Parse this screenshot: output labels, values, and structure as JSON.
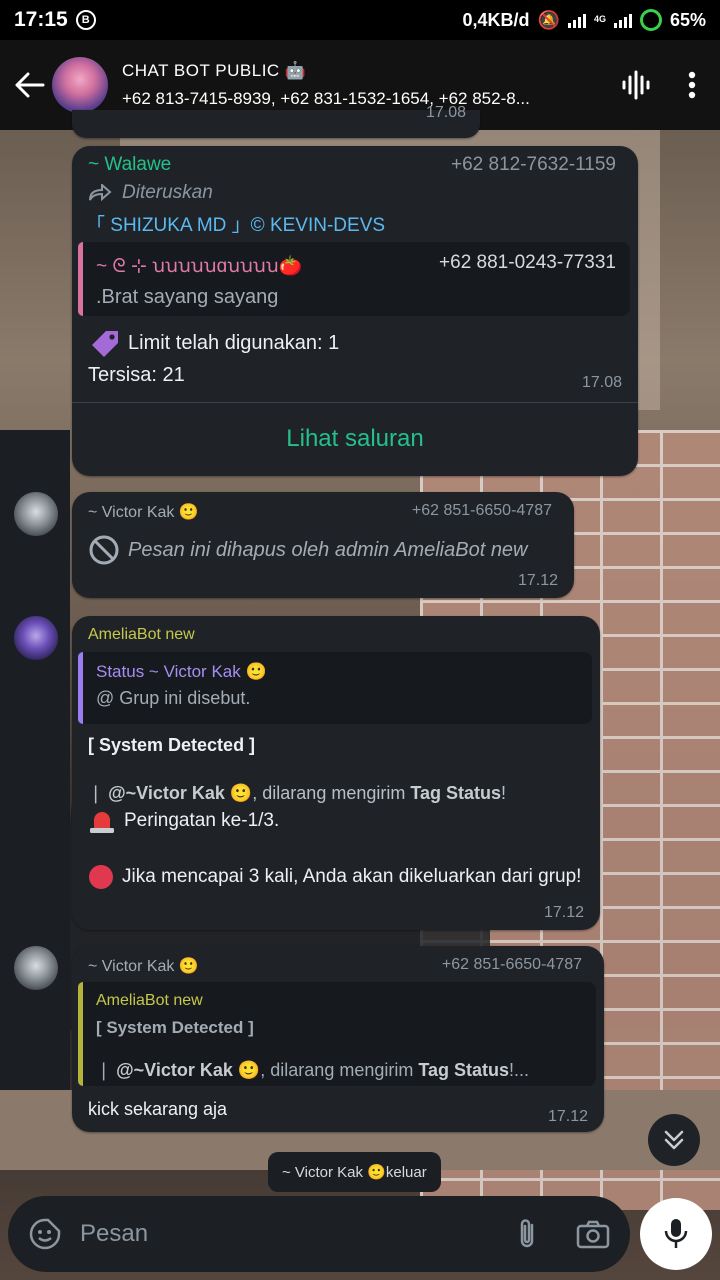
{
  "status_bar": {
    "time": "17:15",
    "app_badge": "B",
    "network_speed": "0,4KB/d",
    "network_type": "4G",
    "battery": "65%"
  },
  "header": {
    "title": "CHAT BOT PUBLIC 🤖",
    "subtitle": "+62 813-7415-8939, +62 831-1532-1654, +62 852-8..."
  },
  "prev_time": "17.08",
  "messages": {
    "walawe": {
      "sender": "~ Walawe",
      "phone": "+62 812-7632-1159",
      "forwarded": "Diteruskan",
      "channel": "「 SHIZUKA MD 」© KEVIN-DEVS",
      "quote_sender": "~ ᘓ ⊹ ꭒꭒꭒꭒꭒɑꭒꭒꭒꭒ🍅",
      "quote_phone": "+62 881-0243-77331",
      "quote_text": ".Brat sayang sayang",
      "line1": "Limit telah digunakan: 1",
      "line2": "Tersisa: 21",
      "time": "17.08",
      "action": "Lihat saluran"
    },
    "victor_deleted": {
      "sender": "~ Victor Kak 🙂",
      "phone": "+62 851-6650-4787",
      "text": "Pesan ini dihapus oleh admin AmeliaBot new",
      "time": "17.12"
    },
    "amelia": {
      "sender": "AmeliaBot new",
      "quote_title": "Status ~ Victor Kak 🙂",
      "quote_text": "@ Grup ini disebut.",
      "heading": "[ System Detected ]",
      "line_prefix": "❘ ",
      "mention": "@~Victor Kak 🙂",
      "line_mid": ", dilarang mengirim ",
      "tag": "Tag Status",
      "line_end": "!",
      "warning": "Peringatan ke-1/3.",
      "kick_notice": "Jika mencapai 3 kali, Anda akan dikeluarkan dari grup!",
      "time": "17.12"
    },
    "victor_reply": {
      "sender": "~ Victor Kak 🙂",
      "phone": "+62 851-6650-4787",
      "quote_sender": "AmeliaBot new",
      "quote_heading": "[ System Detected ]",
      "quote_prefix": "❘ ",
      "quote_mention": "@~Victor Kak 🙂",
      "quote_mid": ", dilarang mengirim ",
      "quote_tag": "Tag Status",
      "quote_end": "!...",
      "text": "kick sekarang aja",
      "time": "17.12"
    }
  },
  "system_event": {
    "name": "~ Victor Kak 🙂",
    "action": " keluar"
  },
  "input": {
    "placeholder": "Pesan"
  },
  "colors": {
    "accent_green": "#25c08a",
    "quote_pink": "#d8739f",
    "quote_purple": "#9d7ef0",
    "quote_olive": "#b4b33a",
    "bubble": "#1f2328"
  }
}
